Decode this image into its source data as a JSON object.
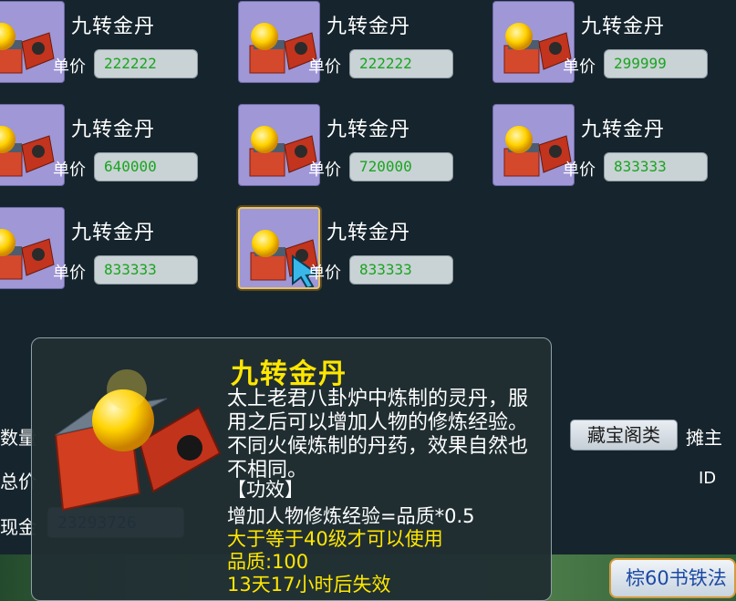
{
  "items": [
    {
      "name": "九转金丹",
      "price_label": "单价",
      "price": "222222"
    },
    {
      "name": "九转金丹",
      "price_label": "单价",
      "price": "222222"
    },
    {
      "name": "九转金丹",
      "price_label": "单价",
      "price": "299999"
    },
    {
      "name": "九转金丹",
      "price_label": "单价",
      "price": "640000"
    },
    {
      "name": "九转金丹",
      "price_label": "单价",
      "price": "720000"
    },
    {
      "name": "九转金丹",
      "price_label": "单价",
      "price": "833333"
    },
    {
      "name": "九转金丹",
      "price_label": "单价",
      "price": "833333"
    },
    {
      "name": "九转金丹",
      "price_label": "单价",
      "price": "833333"
    }
  ],
  "left_panel": {
    "quantity_label": "数量",
    "total_label": "总价",
    "cash_label": "现金",
    "cash_value": "23293726"
  },
  "buttons": {
    "treasure_category": "藏宝阁类",
    "stall_owner": "摊主",
    "id_label": "ID",
    "footer": "棕60书铁法"
  },
  "tooltip": {
    "title": "九转金丹",
    "description": "太上老君八卦炉中炼制的灵丹，服用之后可以增加人物的修炼经验。不同火候炼制的丹药，效果自然也不相同。",
    "effect_header": "【功效】",
    "effect_line": "增加人物修炼经验=品质*0.5",
    "level_requirement": "大于等于40级才可以使用",
    "quality": "品质:100",
    "expiry": "13天17小时后失效"
  },
  "colors": {
    "background": "#16252d",
    "slot": "#9f97d6",
    "price_text": "#19a51f",
    "tooltip_title": "#ffe600"
  }
}
